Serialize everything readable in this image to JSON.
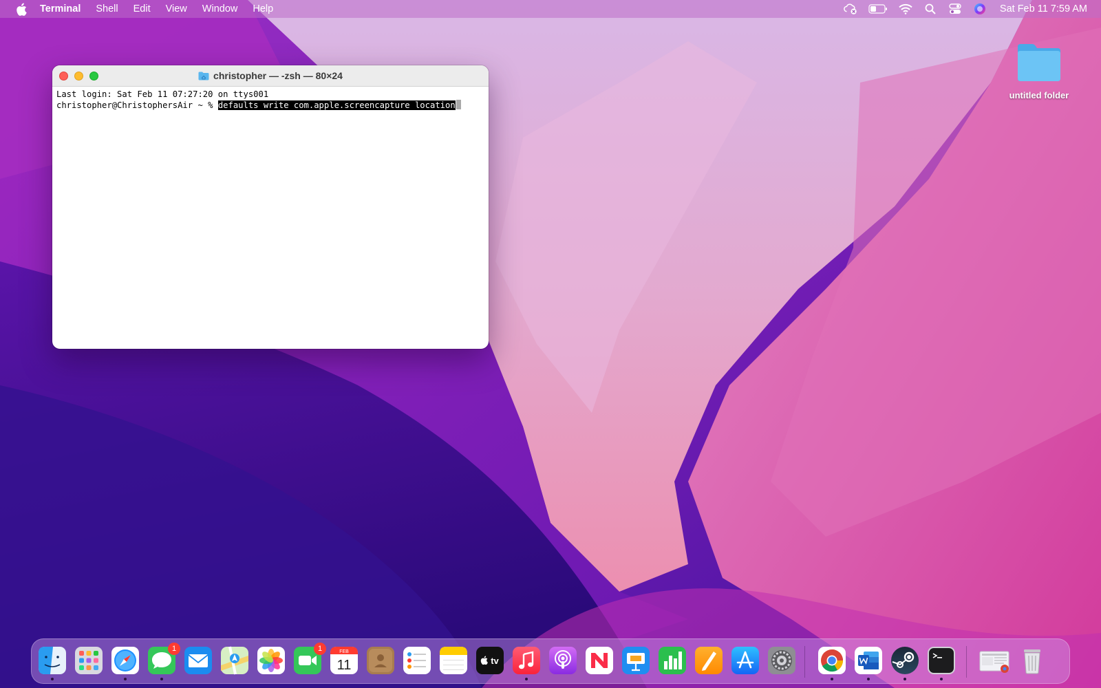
{
  "menubar": {
    "app_name": "Terminal",
    "menus": [
      "Shell",
      "Edit",
      "View",
      "Window",
      "Help"
    ],
    "status_icons": [
      "icloud-error-icon",
      "battery-icon",
      "wifi-icon",
      "spotlight-icon",
      "control-center-icon",
      "siri-icon"
    ],
    "clock": "Sat Feb 11  7:59 AM"
  },
  "terminal": {
    "title": "christopher — -zsh — 80×24",
    "lines": {
      "login": "Last login: Sat Feb 11 07:27:20 on ttys001",
      "prompt": "christopher@ChristophersAir ~ % ",
      "command": "defaults write com.apple.screencapture location"
    }
  },
  "desktop": {
    "folder_label": "untitled folder"
  },
  "dock": {
    "apps": [
      {
        "name": "finder-icon",
        "running": true,
        "badge": ""
      },
      {
        "name": "launchpad-icon",
        "running": false,
        "badge": ""
      },
      {
        "name": "safari-icon",
        "running": true,
        "badge": ""
      },
      {
        "name": "messages-icon",
        "running": true,
        "badge": "1"
      },
      {
        "name": "mail-icon",
        "running": false,
        "badge": ""
      },
      {
        "name": "maps-icon",
        "running": false,
        "badge": ""
      },
      {
        "name": "photos-icon",
        "running": false,
        "badge": ""
      },
      {
        "name": "facetime-icon",
        "running": false,
        "badge": "1"
      },
      {
        "name": "calendar-icon",
        "running": false,
        "badge": ""
      },
      {
        "name": "contacts-icon",
        "running": false,
        "badge": ""
      },
      {
        "name": "reminders-icon",
        "running": false,
        "badge": ""
      },
      {
        "name": "notes-icon",
        "running": false,
        "badge": ""
      },
      {
        "name": "apple-tv-icon",
        "running": false,
        "badge": ""
      },
      {
        "name": "music-icon",
        "running": true,
        "badge": ""
      },
      {
        "name": "podcasts-icon",
        "running": false,
        "badge": ""
      },
      {
        "name": "news-icon",
        "running": false,
        "badge": ""
      },
      {
        "name": "keynote-icon",
        "running": false,
        "badge": ""
      },
      {
        "name": "numbers-icon",
        "running": false,
        "badge": ""
      },
      {
        "name": "pages-icon",
        "running": false,
        "badge": ""
      },
      {
        "name": "app-store-icon",
        "running": false,
        "badge": ""
      },
      {
        "name": "system-preferences-icon",
        "running": false,
        "badge": ""
      },
      {
        "name": "chrome-icon",
        "running": true,
        "badge": ""
      },
      {
        "name": "word-icon",
        "running": true,
        "badge": ""
      },
      {
        "name": "steam-icon",
        "running": true,
        "badge": ""
      },
      {
        "name": "terminal-icon",
        "running": true,
        "badge": ""
      },
      {
        "name": "downloads-stack-icon",
        "running": false,
        "badge": ""
      },
      {
        "name": "trash-icon",
        "running": false,
        "badge": ""
      }
    ],
    "calendar": {
      "month": "FEB",
      "day": "11"
    },
    "appletv_label": "tv"
  }
}
